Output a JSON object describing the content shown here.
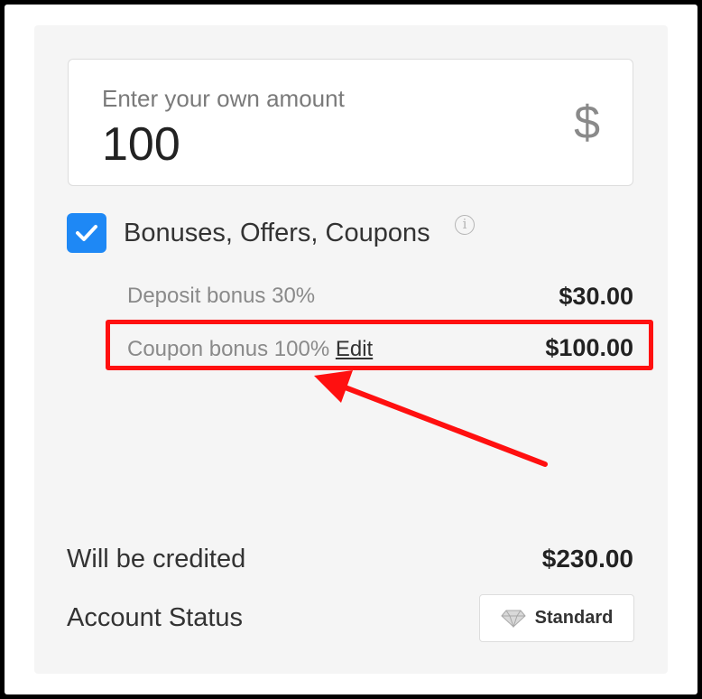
{
  "amount_input": {
    "label": "Enter your own amount",
    "value": "100",
    "currency_symbol": "$"
  },
  "bonuses": {
    "checked": true,
    "title": "Bonuses, Offers, Coupons",
    "info_icon": "info-icon",
    "rows": [
      {
        "label": "Deposit bonus 30%",
        "amount": "$30.00"
      },
      {
        "label": "Coupon bonus 100%",
        "link": "Edit",
        "amount": "$100.00"
      }
    ]
  },
  "summary": {
    "credited_label": "Will be credited",
    "credited_amount": "$230.00",
    "status_label": "Account Status",
    "status_value": "Standard",
    "status_icon": "diamond-icon"
  },
  "colors": {
    "accent": "#1e88f5",
    "highlight": "#ff1010"
  }
}
